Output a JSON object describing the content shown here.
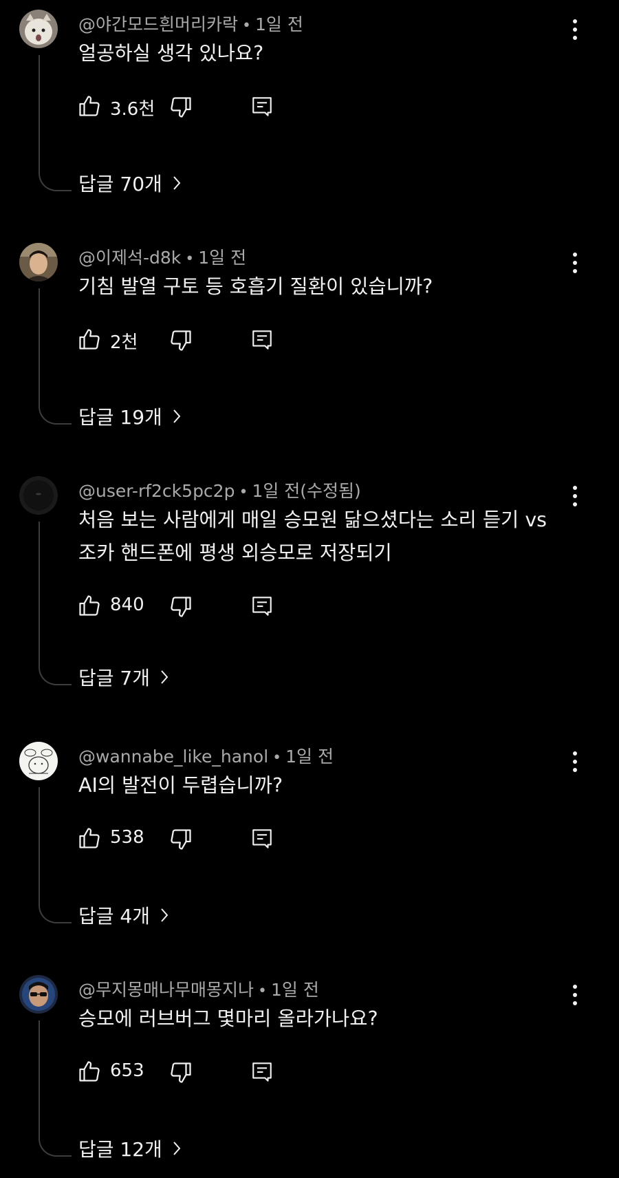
{
  "comments": [
    {
      "author": "@야간모드흰머리카락",
      "time": "1일 전",
      "lines": [
        "얼공하실 생각 있나요?"
      ],
      "likes": "3.6천",
      "replies": "답글 70개"
    },
    {
      "author": "@이제석-d8k",
      "time": "1일 전",
      "lines": [
        "기침 발열 구토 등 호흡기 질환이 있습니까?"
      ],
      "likes": "2천",
      "replies": "답글 19개"
    },
    {
      "author": "@user-rf2ck5pc2p",
      "time": "1일 전(수정됨)",
      "lines": [
        "처음 보는 사람에게 매일 승모원 닮으셨다는 소리 듣기 vs",
        "조카 핸드폰에 평생 외승모로 저장되기"
      ],
      "likes": "840",
      "replies": "답글 7개"
    },
    {
      "author": "@wannabe_like_hanol",
      "time": "1일 전",
      "lines": [
        "AI의 발전이 두렵습니까?"
      ],
      "likes": "538",
      "replies": "답글 4개"
    },
    {
      "author": "@무지몽매나무매몽지나",
      "time": "1일 전",
      "lines": [
        "승모에 러브버그 몇마리 올라가나요?"
      ],
      "likes": "653",
      "replies": "답글 12개"
    }
  ],
  "icons": {
    "like": "thumb-up-icon",
    "dislike": "thumb-down-icon",
    "reply": "comment-reply-icon",
    "more": "more-vertical-icon",
    "chevron": "chevron-right-icon"
  }
}
